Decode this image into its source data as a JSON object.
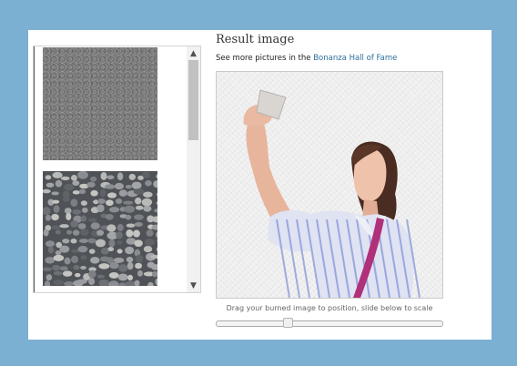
{
  "thumbnails": [
    {
      "texture": "asphalt"
    },
    {
      "texture": "pebbles"
    }
  ],
  "scrollbar": {
    "up_glyph": "▲",
    "down_glyph": "▼"
  },
  "result": {
    "title": "Result image",
    "see_more_prefix": "See more pictures in the ",
    "hall_of_fame_link": "Bonanza Hall of Fame",
    "caption": "Drag your burned image to position, slide below to scale"
  },
  "scale_slider": {
    "value_fraction": 0.31
  },
  "colors": {
    "page_background": "#7bb0d3",
    "link": "#2c6f9e",
    "shirt_stripe": "#7f8fd6",
    "strap": "#b0307a"
  }
}
